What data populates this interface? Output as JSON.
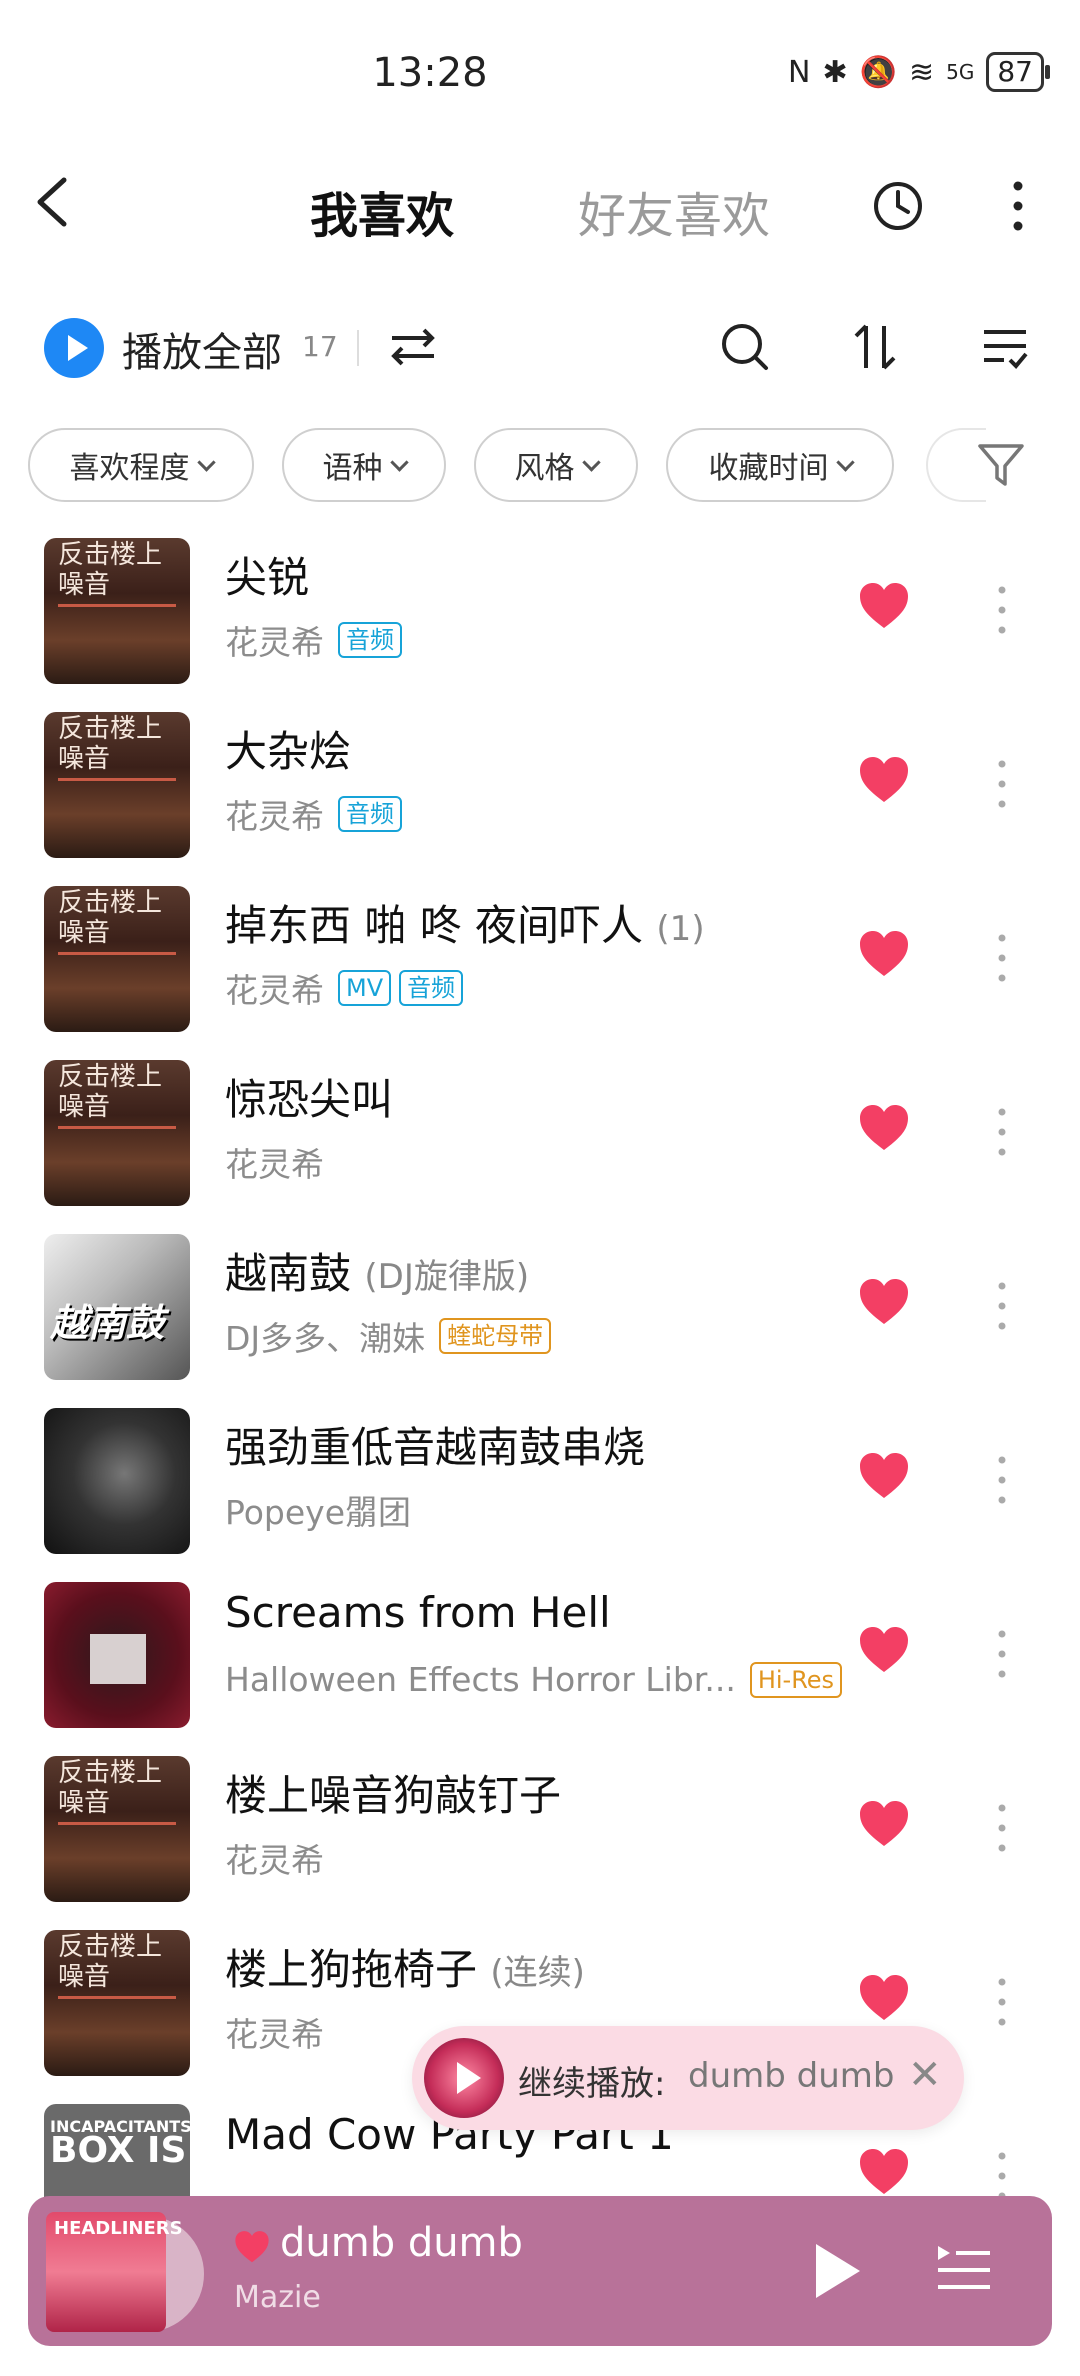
{
  "status": {
    "time": "13:28",
    "battery": "87",
    "signal_label": "5G"
  },
  "header": {
    "tab_active": "我喜欢",
    "tab_inactive": "好友喜欢"
  },
  "toolbar": {
    "play_all": "播放全部",
    "count": "17"
  },
  "filters": [
    "喜欢程度",
    "语种",
    "风格",
    "收藏时间"
  ],
  "songs": [
    {
      "title": "尖锐",
      "suffix": "",
      "artist": "花灵希",
      "tags": [
        "音频"
      ],
      "cover_text": [
        "反击楼上",
        "噪音"
      ]
    },
    {
      "title": "大杂烩",
      "suffix": "",
      "artist": "花灵希",
      "tags": [
        "音频"
      ],
      "cover_text": [
        "反击楼上",
        "噪音"
      ]
    },
    {
      "title": "掉东西 啪 咚 夜间吓人",
      "suffix": "(1)",
      "artist": "花灵希",
      "tags": [
        "MV",
        "音频"
      ],
      "cover_text": [
        "反击楼上",
        "噪音"
      ]
    },
    {
      "title": "惊恐尖叫",
      "suffix": "",
      "artist": "花灵希",
      "tags": [],
      "cover_text": [
        "反击楼上",
        "噪音"
      ]
    },
    {
      "title": "越南鼓",
      "suffix": "(DJ旋律版)",
      "artist": "DJ多多、潮妹",
      "tags": [
        "蝰蛇母带"
      ],
      "cover_text": [
        "越南鼓"
      ]
    },
    {
      "title": "强劲重低音越南鼓串烧",
      "suffix": "",
      "artist": "Popeye朤团",
      "tags": [],
      "cover_text": []
    },
    {
      "title": "Screams from Hell",
      "suffix": "",
      "artist": "Halloween Effects Horror Libr...",
      "tags": [
        "Hi-Res"
      ],
      "cover_text": []
    },
    {
      "title": "楼上噪音狗敲钉子",
      "suffix": "",
      "artist": "花灵希",
      "tags": [],
      "cover_text": [
        "反击楼上",
        "噪音"
      ]
    },
    {
      "title": "楼上狗拖椅子",
      "suffix": "(连续)",
      "artist": "花灵希",
      "tags": [],
      "cover_text": [
        "反击楼上",
        "噪音"
      ]
    },
    {
      "title": "Mad Cow Party Part 1",
      "suffix": "",
      "artist": "",
      "tags": [],
      "cover_text": [
        "INCAPACITANTS",
        "BOX IS"
      ]
    }
  ],
  "toast": {
    "label": "继续播放:",
    "song": "dumb dumb",
    "close": "✕"
  },
  "player": {
    "song": "dumb dumb",
    "artist": "Mazie",
    "cover_text": "HEADLINERS"
  },
  "colors": {
    "accent_blue": "#1e88f5",
    "heart": "#f33f64",
    "player_bg": "#b87299",
    "toast_bg": "#fbdbe4"
  }
}
